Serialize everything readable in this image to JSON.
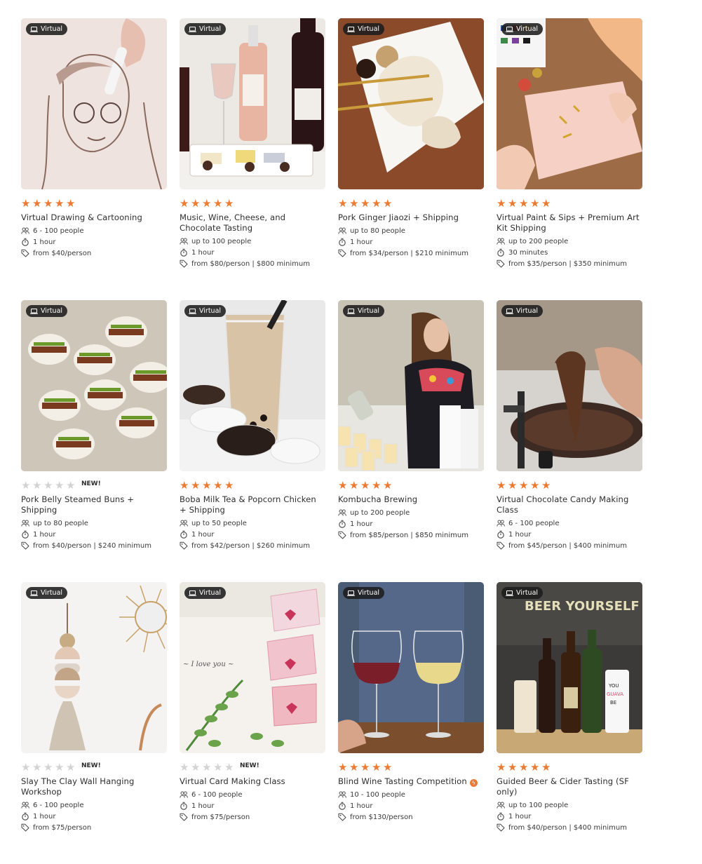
{
  "badge_label": "Virtual",
  "new_label": "NEW!",
  "colors": {
    "star_on": "#ec7a33",
    "star_off": "#d3d3d3",
    "badge_bg": "#1c1c1c"
  },
  "icons": {
    "badge": "laptop-icon",
    "people": "people-icon",
    "duration": "stopwatch-icon",
    "price": "price-tag-icon",
    "star": "star-icon",
    "featured": "lightning-icon"
  },
  "experiences": [
    {
      "title": "Virtual Drawing & Cartooning",
      "rating": 5,
      "is_new": false,
      "featured": false,
      "people": "6 - 100 people",
      "duration": "1 hour",
      "price": "from $40/person",
      "photo": "drawing"
    },
    {
      "title": "Music, Wine, Cheese, and Chocolate Tasting",
      "rating": 5,
      "is_new": false,
      "featured": false,
      "people": "up to 100 people",
      "duration": "1 hour",
      "price": "from $80/person | $800 minimum",
      "photo": "wine-cheese"
    },
    {
      "title": "Pork Ginger Jiaozi + Shipping",
      "rating": 5,
      "is_new": false,
      "featured": false,
      "people": "up to 80 people",
      "duration": "1 hour",
      "price": "from $34/person | $210 minimum",
      "photo": "dumpling"
    },
    {
      "title": "Virtual Paint & Sips + Premium Art Kit Shipping",
      "rating": 5,
      "is_new": false,
      "featured": false,
      "people": "up to 200 people",
      "duration": "30 minutes",
      "price": "from $35/person | $350 minimum",
      "photo": "paint"
    },
    {
      "title": "Pork Belly Steamed Buns + Shipping",
      "rating": 0,
      "is_new": true,
      "featured": false,
      "people": "up to 80 people",
      "duration": "1 hour",
      "price": "from $40/person | $240 minimum",
      "photo": "buns"
    },
    {
      "title": "Boba Milk Tea & Popcorn Chicken + Shipping",
      "rating": 5,
      "is_new": false,
      "featured": false,
      "people": "up to 50 people",
      "duration": "1 hour",
      "price": "from $42/person | $260 minimum",
      "photo": "boba"
    },
    {
      "title": "Kombucha Brewing",
      "rating": 5,
      "is_new": false,
      "featured": false,
      "people": "up to 200 people",
      "duration": "1 hour",
      "price": "from $85/person | $850 minimum",
      "photo": "kombucha"
    },
    {
      "title": "Virtual Chocolate Candy Making Class",
      "rating": 5,
      "is_new": false,
      "featured": false,
      "people": "6 - 100 people",
      "duration": "1 hour",
      "price": "from $45/person | $400 minimum",
      "photo": "chocolate"
    },
    {
      "title": "Slay The Clay Wall Hanging Workshop",
      "rating": 0,
      "is_new": true,
      "featured": false,
      "people": "6 - 100 people",
      "duration": "1 hour",
      "price": "from $75/person",
      "photo": "clay"
    },
    {
      "title": "Virtual Card Making Class",
      "rating": 0,
      "is_new": true,
      "featured": false,
      "people": "6 - 100 people",
      "duration": "1 hour",
      "price": "from $75/person",
      "photo": "cards"
    },
    {
      "title": "Blind Wine Tasting Competition",
      "rating": 5,
      "is_new": false,
      "featured": true,
      "people": "10 - 100 people",
      "duration": "1 hour",
      "price": "from $130/person",
      "photo": "wine-glasses"
    },
    {
      "title": "Guided Beer & Cider Tasting (SF only)",
      "rating": 5,
      "is_new": false,
      "featured": false,
      "people": "up to 100 people",
      "duration": "1 hour",
      "price": "from $40/person | $400 minimum",
      "photo": "beer"
    }
  ]
}
